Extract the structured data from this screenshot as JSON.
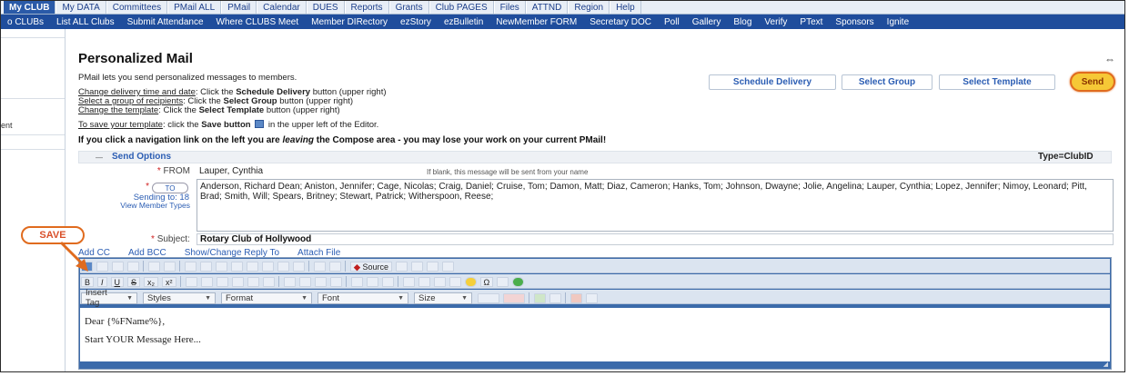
{
  "nav": {
    "tabs": [
      "My CLUB",
      "My DATA",
      "Committees",
      "PMail ALL",
      "PMail",
      "Calendar",
      "DUES",
      "Reports",
      "Grants",
      "Club PAGES",
      "Files",
      "ATTND",
      "Region",
      "Help"
    ],
    "subnav": [
      "o CLUBs",
      "List ALL Clubs",
      "Submit Attendance",
      "Where CLUBS Meet",
      "Member DIRectory",
      "ezStory",
      "ezBulletin",
      "NewMember FORM",
      "Secretary DOC",
      "Poll",
      "Gallery",
      "Blog",
      "Verify",
      "PText",
      "Sponsors",
      "Ignite"
    ]
  },
  "sidebar": {
    "item": "ent"
  },
  "page": {
    "title": "Personalized Mail",
    "intro": "PMail lets you send personalized messages to members.",
    "help1_link": "Change delivery time and date",
    "help1_pre": ": Click the ",
    "help1_bold": "Schedule Delivery",
    "help1_post": " button (upper right)",
    "help2_link": "Select a group of recipients",
    "help2_pre": ": Click the ",
    "help2_bold": "Select Group",
    "help2_post": " button (upper right)",
    "help3_link": "Change the template",
    "help3_pre": ": Click the ",
    "help3_bold": "Select Template",
    "help3_post": " button (upper right)",
    "save_link": "To save your template",
    "save_pre": ": click the ",
    "save_bold": "Save button",
    "save_post": " in the upper left of the Editor.",
    "warn_pre": "If you click a navigation link on the left you are ",
    "warn_em": "leaving",
    "warn_post": " the Compose area - you may lose your work on your current PMail!"
  },
  "actions": {
    "schedule": "Schedule Delivery",
    "group": "Select Group",
    "template": "Select Template",
    "send": "Send"
  },
  "form": {
    "options_toggle": "—",
    "options_title": "Send Options",
    "type": "Type=ClubID",
    "from_label": "FROM",
    "from_value": "Lauper, Cynthia",
    "from_hint": "If blank, this message will be sent from your name",
    "to_button": "TO",
    "sending_to": "Sending to: 18",
    "view_types": "View Member Types",
    "recipients": "Anderson, Richard Dean; Aniston, Jennifer; Cage, Nicolas; Craig, Daniel; Cruise, Tom; Damon, Matt; Diaz, Cameron; Hanks, Tom; Johnson, Dwayne; Jolie, Angelina; Lauper, Cynthia; Lopez, Jennifer; Nimoy, Leonard; Pitt, Brad; Smith, Will; Spears, Britney; Stewart, Patrick; Witherspoon, Reese;",
    "subject_label": "Subject:",
    "subject_value": "Rotary Club of Hollywood",
    "link_cc": "Add CC",
    "link_bcc": "Add BCC",
    "link_reply": "Show/Change Reply To",
    "link_attach": "Attach File"
  },
  "callout": {
    "save": "SAVE"
  },
  "editor": {
    "source": "Source",
    "insert_tag": "Insert Tag",
    "styles": "Styles",
    "format": "Format",
    "font": "Font",
    "size": "Size",
    "line1": "Dear {%FName%},",
    "line2": "Start YOUR Message Here..."
  },
  "colors": {
    "nav_blue": "#1f4d9c",
    "link_blue": "#2b5db3",
    "send_yellow": "#f6c836",
    "callout_orange": "#e06b1e"
  }
}
